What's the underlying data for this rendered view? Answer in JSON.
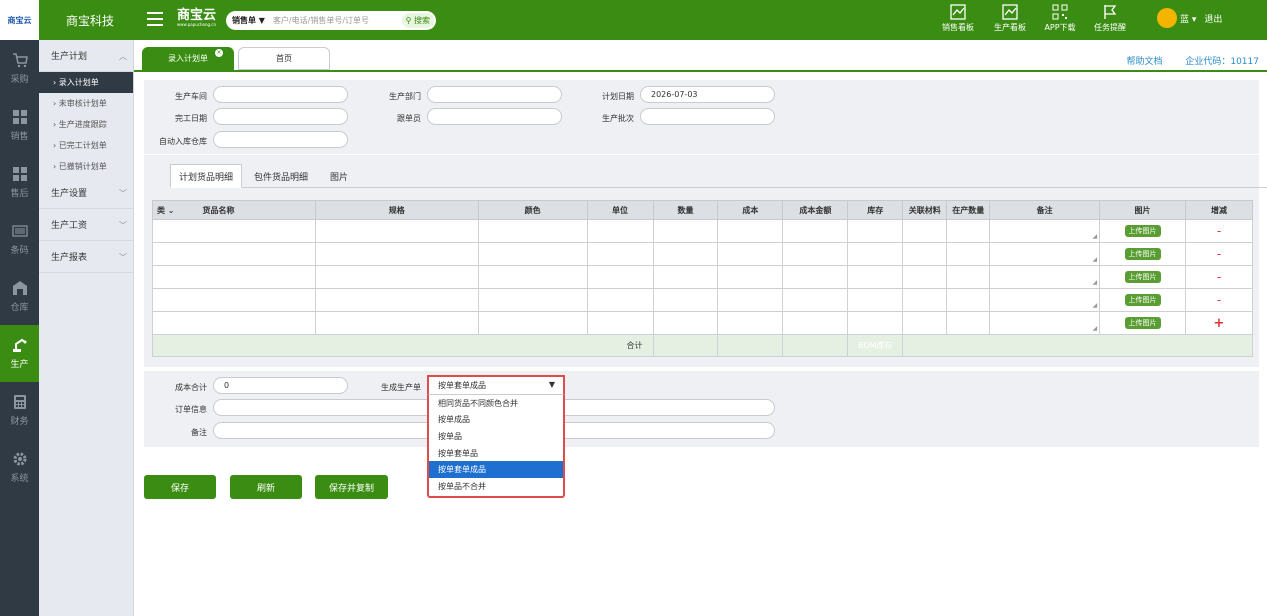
{
  "logo": {
    "text": "商宝云"
  },
  "header": {
    "company": "商宝科技",
    "brand": "商宝云",
    "brand_sub": "www.papuchong.cn",
    "search_select": "销售单 ▼",
    "search_placeholder": "客户/电话/销售单号/订单号",
    "search_button": "搜索",
    "tools": [
      "销售看板",
      "生产看板",
      "APP下载",
      "任务提醒"
    ],
    "user_name": "蓝 ▾",
    "logout": "退出"
  },
  "leftnav": [
    {
      "label": "采购",
      "icon": "cart-icon"
    },
    {
      "label": "销售",
      "icon": "grid-icon"
    },
    {
      "label": "售后",
      "icon": "grid-icon"
    },
    {
      "label": "条码",
      "icon": "barcode-icon"
    },
    {
      "label": "仓库",
      "icon": "warehouse-icon"
    },
    {
      "label": "生产",
      "icon": "robot-arm-icon",
      "active": true
    },
    {
      "label": "财务",
      "icon": "calculator-icon"
    },
    {
      "label": "系统",
      "icon": "gear-icon"
    }
  ],
  "submenu": {
    "group1": "生产计划",
    "items": [
      "› 录入计划单",
      "› 未审核计划单",
      "› 生产进度跟踪",
      "› 已完工计划单",
      "› 已撤销计划单"
    ],
    "group2": "生产设置",
    "group3": "生产工资",
    "group4": "生产报表"
  },
  "tabs": {
    "active": "录入计划单",
    "home": "首页",
    "close": "×"
  },
  "toplinks": {
    "help": "帮助文档",
    "code": "企业代码：10117"
  },
  "form": {
    "workshop_label": "生产车间",
    "dept_label": "生产部门",
    "plan_date_label": "计划日期",
    "plan_date_value": "2026-07-03",
    "finish_date_label": "完工日期",
    "follower_label": "跟单员",
    "batch_label": "生产批次",
    "auto_warehouse_label": "自动入库仓库"
  },
  "detail_tabs": [
    "计划货品明细",
    "包件货品明细",
    "图片"
  ],
  "table": {
    "headers": [
      "类 ⌄",
      "货品名称",
      "规格",
      "颜色",
      "单位",
      "数量",
      "成本",
      "成本金额",
      "库存",
      "关联材料",
      "在产数量",
      "备注",
      "图片",
      "增减"
    ],
    "upload_label": "上传图片",
    "minus": "-",
    "plus": "+",
    "sum_label": "合计",
    "bom_label": "BOM库存",
    "rows": 5
  },
  "bottom": {
    "cost_total_label": "成本合计",
    "cost_total_value": "0",
    "gen_order_label": "生成生产单",
    "gen_order_value": "按单套单成品",
    "order_info_label": "订单信息",
    "note_label": "备注"
  },
  "dropdown_options": [
    "相同货品不同颜色合并",
    "按单成品",
    "按单品",
    "按单套单品",
    "按单套单成品",
    "按单品不合并"
  ],
  "dropdown_selected_index": 4,
  "buttons": {
    "save": "保存",
    "refresh": "刷新",
    "save_copy": "保存并复制"
  }
}
